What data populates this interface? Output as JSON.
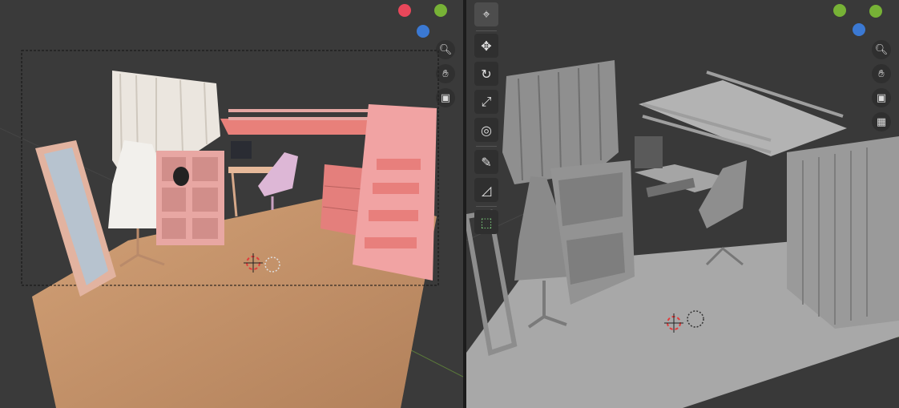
{
  "app": "Blender 3D viewport",
  "left_viewport": {
    "mode": "rendered",
    "nav_icons": [
      "zoom-icon",
      "hand-pan-icon",
      "camera-icon"
    ],
    "gizmo_colors": {
      "x": "#e8475a",
      "y": "#77b236",
      "z": "#3b79d3"
    }
  },
  "right_viewport": {
    "mode": "solid",
    "nav_icons": [
      "zoom-icon",
      "hand-pan-icon",
      "camera-icon",
      "grid-icon"
    ],
    "gizmo_colors": {
      "x": "#e8475a",
      "y": "#77b236",
      "z": "#3b79d3"
    }
  },
  "toolbar": {
    "tools": [
      "cursor-tool-icon",
      "move-tool-icon",
      "rotate-tool-icon",
      "scale-tool-icon",
      "transform-tool-icon",
      "annotate-tool-icon",
      "measure-tool-icon",
      "add-cube-tool-icon"
    ],
    "active_tool": "cursor-tool-icon"
  },
  "colors": {
    "background": "#3a3a3a",
    "floor_wood": "#c7936a",
    "furniture_pink": "#e79a98",
    "solid_gray": "#9a9a9a"
  }
}
